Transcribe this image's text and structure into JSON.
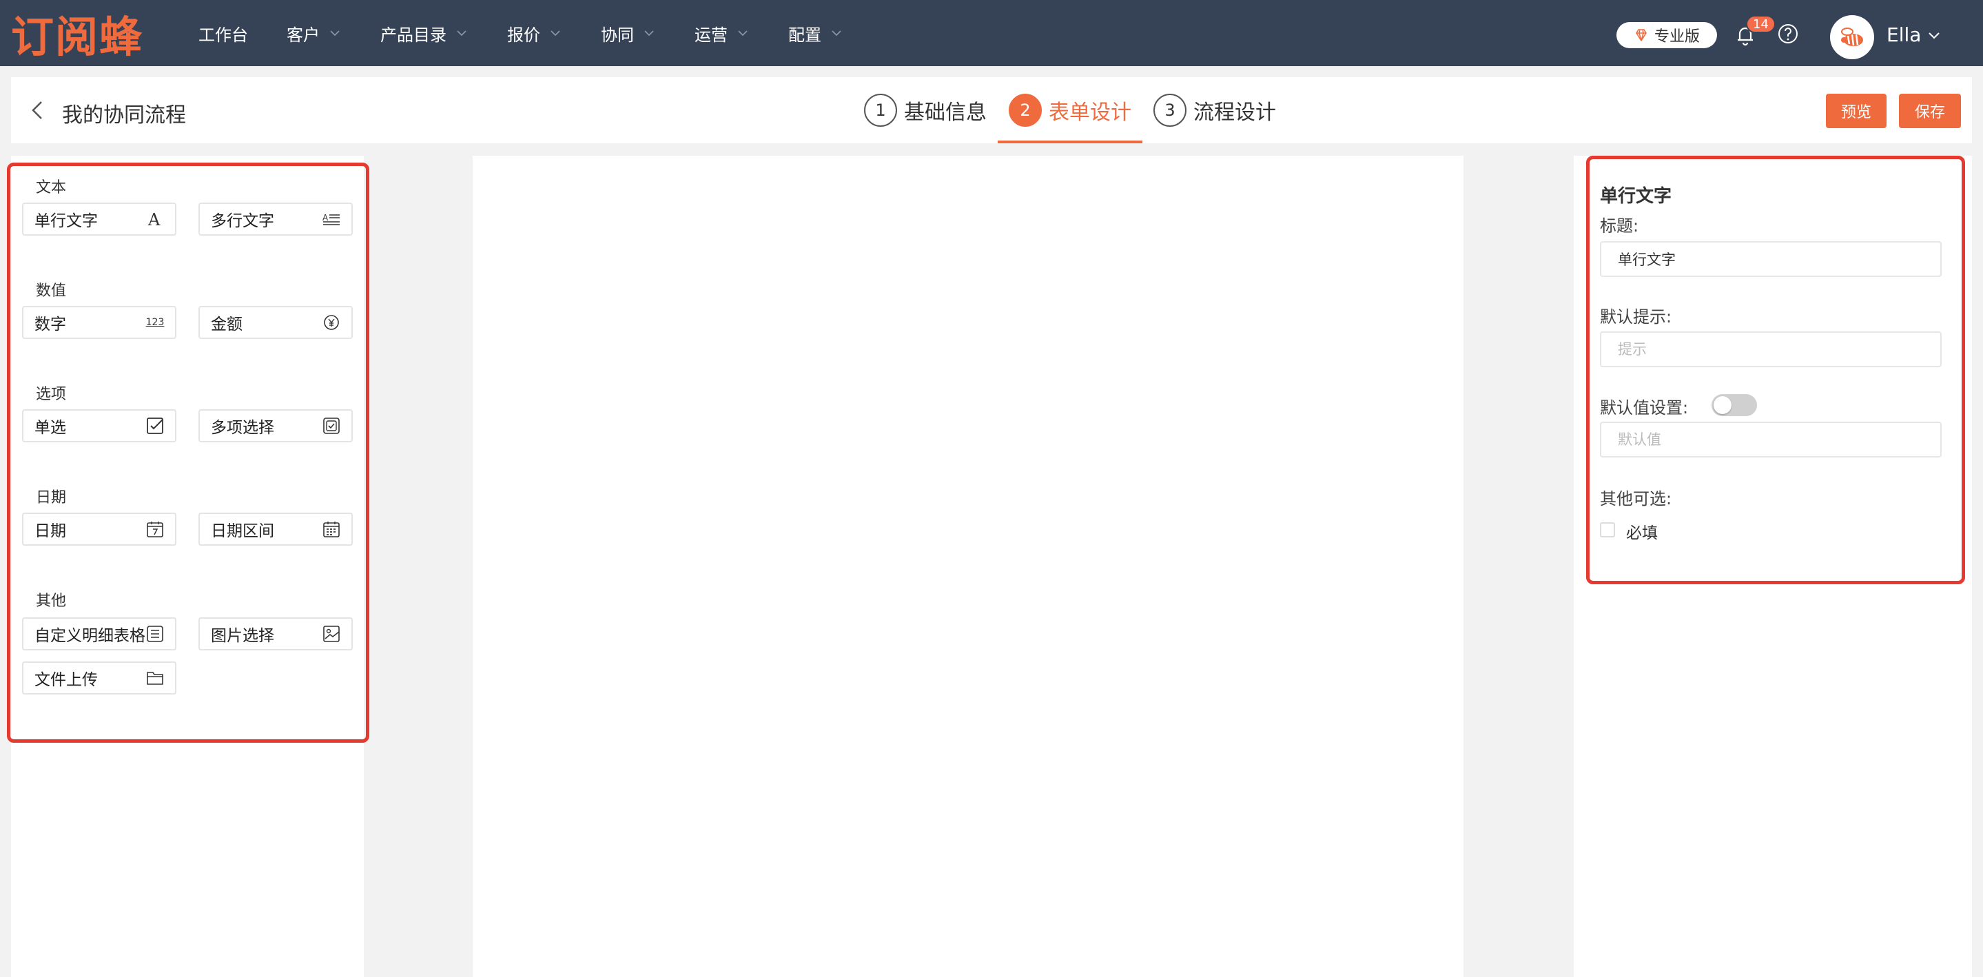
{
  "app": {
    "logo_text": "订阅蜂",
    "nav": [
      {
        "label": "工作台",
        "has_dropdown": false
      },
      {
        "label": "客户",
        "has_dropdown": true
      },
      {
        "label": "产品目录",
        "has_dropdown": true
      },
      {
        "label": "报价",
        "has_dropdown": true
      },
      {
        "label": "协同",
        "has_dropdown": true
      },
      {
        "label": "运营",
        "has_dropdown": true
      },
      {
        "label": "配置",
        "has_dropdown": true
      }
    ],
    "pro_badge": "专业版",
    "notification_count": "14",
    "user_name": "Ella",
    "colors": {
      "topbar": "#364357",
      "accent": "#ef6b3d",
      "highlight_frame": "#e53a2f"
    }
  },
  "subheader": {
    "title": "我的协同流程",
    "steps": [
      {
        "num": "1",
        "label": "基础信息",
        "active": false
      },
      {
        "num": "2",
        "label": "表单设计",
        "active": true
      },
      {
        "num": "3",
        "label": "流程设计",
        "active": false
      }
    ],
    "preview_label": "预览",
    "save_label": "保存"
  },
  "components": {
    "groups": [
      {
        "title": "文本",
        "items": [
          {
            "label": "单行文字",
            "icon": "font-icon"
          },
          {
            "label": "多行文字",
            "icon": "multiline-text-icon"
          }
        ]
      },
      {
        "title": "数值",
        "items": [
          {
            "label": "数字",
            "icon": "number-icon"
          },
          {
            "label": "金额",
            "icon": "currency-icon"
          }
        ]
      },
      {
        "title": "选项",
        "items": [
          {
            "label": "单选",
            "icon": "checkbox-icon"
          },
          {
            "label": "多项选择",
            "icon": "multi-checkbox-icon"
          }
        ]
      },
      {
        "title": "日期",
        "items": [
          {
            "label": "日期",
            "icon": "calendar-icon"
          },
          {
            "label": "日期区间",
            "icon": "calendar-range-icon"
          }
        ]
      },
      {
        "title": "其他",
        "items": [
          {
            "label": "自定义明细表格",
            "icon": "list-icon"
          },
          {
            "label": "图片选择",
            "icon": "image-icon"
          },
          {
            "label": "文件上传",
            "icon": "folder-icon"
          }
        ]
      }
    ],
    "number_icon_text": "123"
  },
  "properties": {
    "heading": "单行文字",
    "title_label": "标题:",
    "title_value": "单行文字",
    "hint_label": "默认提示:",
    "hint_placeholder": "提示",
    "default_label": "默认值设置:",
    "default_enabled": false,
    "default_placeholder": "默认值",
    "other_label": "其他可选:",
    "required_label": "必填",
    "required_checked": false
  }
}
